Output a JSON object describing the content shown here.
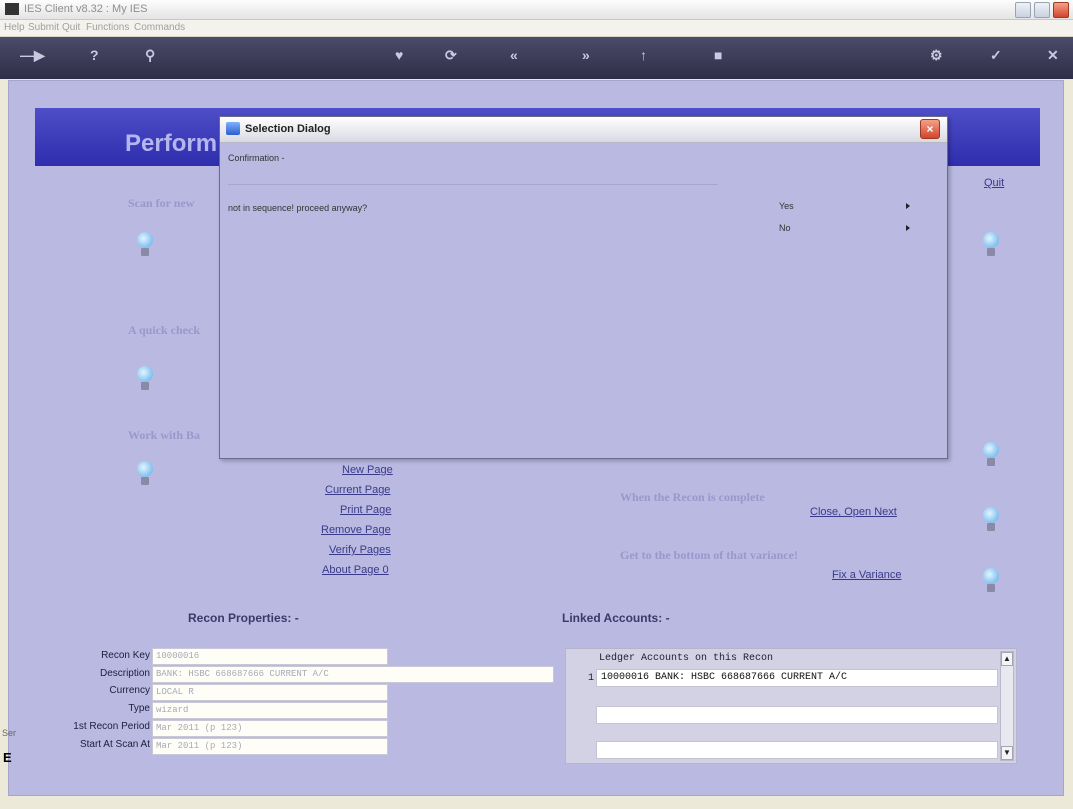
{
  "window": {
    "title": "IES Client v8.32 : My IES",
    "menu": [
      "Help",
      "Submit",
      "Quit",
      "Functions",
      "Commands"
    ]
  },
  "toolbar": {
    "icons": [
      "arrow-icon",
      "help-icon",
      "search-icon",
      "heart-icon",
      "refresh-icon",
      "back-icon",
      "forward-icon",
      "up-icon",
      "square-icon",
      "settings-icon",
      "check-icon",
      "close-icon"
    ]
  },
  "header": {
    "title": "Perform"
  },
  "quit_label": "Quit",
  "sections": {
    "scan": "Scan for new",
    "quick": "A quick check",
    "work": "Work with Ba"
  },
  "page_links": [
    "New Page",
    "Current Page",
    "Print Page",
    "Remove Page",
    "Verify Pages",
    "About Page 0"
  ],
  "right_panel": {
    "complete_text": "When the Recon is complete",
    "close_link": "Close, Open Next",
    "variance_text": "Get to the bottom of that variance!",
    "variance_link": "Fix a Variance"
  },
  "recon_properties": {
    "title": "Recon Properties: -",
    "fields": [
      {
        "label": "Recon Key",
        "value": "10000016"
      },
      {
        "label": "Description",
        "value": "BANK: HSBC 668687666 CURRENT A/C"
      },
      {
        "label": "Currency",
        "value": "LOCAL R"
      },
      {
        "label": "Type",
        "value": "wizard"
      },
      {
        "label": "1st Recon Period",
        "value": "Mar 2011 (p 123)"
      },
      {
        "label": "Start At Scan At",
        "value": "Mar 2011 (p 123)"
      }
    ]
  },
  "linked_accounts": {
    "title": "Linked Accounts: -",
    "header": "Ledger Accounts on this Recon",
    "index": "1",
    "rows": [
      "10000016 BANK: HSBC 668687666 CURRENT A/C",
      "",
      ""
    ]
  },
  "dialog": {
    "title": "Selection Dialog",
    "close": "×",
    "confirmation": "Confirmation -",
    "message": "not in sequence! proceed anyway?",
    "options": [
      "Yes",
      "No"
    ]
  },
  "taskbar_hint": "Ser",
  "taskbar_letter": "E"
}
